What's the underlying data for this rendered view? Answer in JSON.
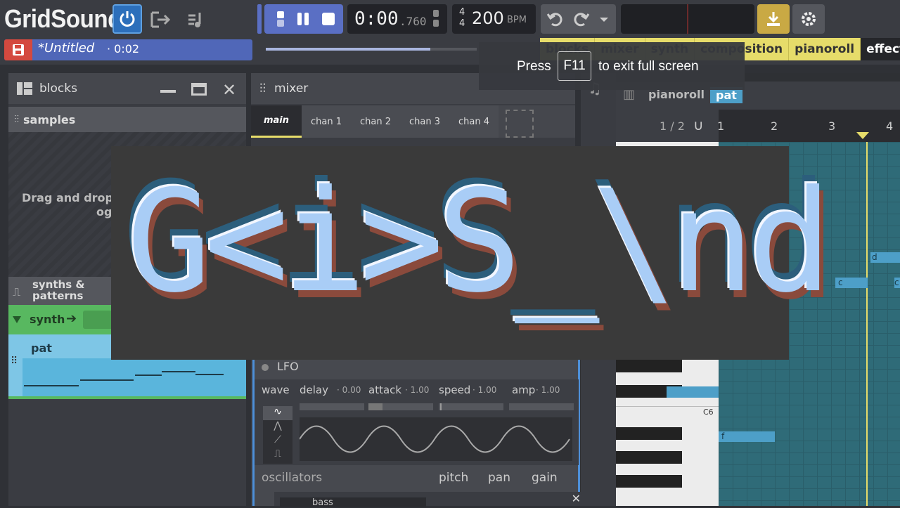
{
  "app": {
    "name": "GridSound"
  },
  "file": {
    "title": "*Untitled",
    "duration": "· 0:02"
  },
  "clock": {
    "main": "0:00",
    "ms": ".760"
  },
  "tempo": {
    "sig_top": "4",
    "sig_bottom": "4",
    "bpm": "200",
    "unit": "BPM"
  },
  "progress": {
    "fraction": 0.78
  },
  "view_tabs": [
    "blocks",
    "mixer",
    "synth",
    "composition",
    "pianoroll",
    "effects"
  ],
  "fullscreen_note": {
    "press": "Press",
    "key": "F11",
    "rest": "to exit full screen"
  },
  "blocks_panel": {
    "title": "blocks",
    "samples_label": "samples",
    "drop_text": "Drag and drop",
    "drop_text2": "og",
    "synths_label": "synths &",
    "synths_label2": "patterns",
    "synth_name": "synth",
    "pattern_name": "pat"
  },
  "mixer_panel": {
    "title": "mixer",
    "tabs": [
      "main",
      "chan 1",
      "chan 2",
      "chan 3",
      "chan 4"
    ]
  },
  "lfo": {
    "title": "LFO",
    "params": [
      {
        "label": "wave",
        "value": ""
      },
      {
        "label": "delay",
        "value": "· 0.00"
      },
      {
        "label": "attack",
        "value": "· 1.00"
      },
      {
        "label": "speed",
        "value": "· 1.00"
      },
      {
        "label": "amp",
        "value": "· 1.00"
      }
    ]
  },
  "oscillators": {
    "title": "oscillators",
    "cols": [
      "pitch",
      "pan",
      "gain"
    ],
    "preset": "bass"
  },
  "pianoroll": {
    "title": "pianoroll",
    "pattern": "pat",
    "zoom": "1 / 2",
    "bars": [
      "1",
      "2",
      "3",
      "4"
    ],
    "octave_label": "C6",
    "notes": [
      "d",
      "c",
      "c",
      "f"
    ]
  },
  "overlay": {
    "title": "G<i>S_\\nd"
  },
  "colors": {
    "accent": "#5a6fc4",
    "grid": "#2f6b78",
    "note": "#4d9fc8",
    "tab_yellow": "#e6dc6a",
    "synth_green": "#58b860",
    "pattern_blue": "#7ec6e6"
  }
}
